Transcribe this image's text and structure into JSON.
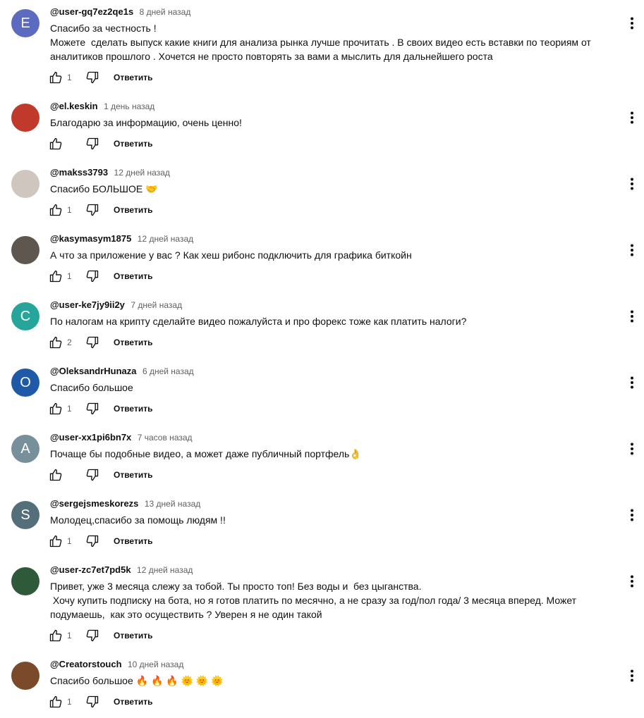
{
  "reply_label": "Ответить",
  "colors": {
    "author": "#0f0f0f",
    "meta": "#606060",
    "text": "#0f0f0f"
  },
  "comments": [
    {
      "author": "@user-gq7ez2qe1s",
      "time": "8 дней назад",
      "text": "Спасибо за честность !\nМожете  сделать выпуск какие книги для анализа рынка лучше прочитать . В своих видео есть вставки по теориям от аналитиков прошлого . Хочется не просто повторять за вами а мыслить для дальнейшего роста",
      "likes": "1",
      "avatar": {
        "letter": "E",
        "color": "#5c6bc0"
      }
    },
    {
      "author": "@el.keskin",
      "time": "1 день назад",
      "text": "Благодарю за информацию, очень ценно!",
      "likes": "",
      "avatar": {
        "letter": "",
        "color": "#c0392b",
        "icon": "user-photo"
      }
    },
    {
      "author": "@makss3793",
      "time": "12 дней назад",
      "text": "Спасибо БОЛЬШОЕ 🤝",
      "likes": "1",
      "avatar": {
        "letter": "",
        "color": "#cfc6c0",
        "icon": "user-photo"
      }
    },
    {
      "author": "@kasymasym1875",
      "time": "12 дней назад",
      "text": "А что за приложение у вас ? Как хеш рибонс подключить для графика биткойн",
      "likes": "1",
      "avatar": {
        "letter": "",
        "color": "#5d5750",
        "icon": "user-photo"
      }
    },
    {
      "author": "@user-ke7jy9ii2y",
      "time": "7 дней назад",
      "text": "По налогам на крипту сделайте видео пожалуйста и про форекс тоже как платить налоги?",
      "likes": "2",
      "avatar": {
        "letter": "C",
        "color": "#26a69a"
      }
    },
    {
      "author": "@OleksandrHunaza",
      "time": "6 дней назад",
      "text": "Спасибо большое",
      "likes": "1",
      "avatar": {
        "letter": "O",
        "color": "#1e5aa8"
      }
    },
    {
      "author": "@user-xx1pi6bn7x",
      "time": "7 часов назад",
      "text": "Почаще бы подобные видео, а может даже публичный портфель👌",
      "likes": "",
      "avatar": {
        "letter": "A",
        "color": "#78909c"
      }
    },
    {
      "author": "@sergejsmeskorezs",
      "time": "13 дней назад",
      "text": "Молодец,спасибо за помощь людям !!",
      "likes": "1",
      "avatar": {
        "letter": "S",
        "color": "#546e7a"
      }
    },
    {
      "author": "@user-zc7et7pd5k",
      "time": "12 дней назад",
      "text": "Привет, уже 3 месяца слежу за тобой. Ты просто топ! Без воды и  без цыганства.\n Хочу купить подписку на бота, но я готов платить по месячно, а не сразу за год/пол года/ 3 месяца вперед. Может подумаешь,  как это осуществить ? Уверен я не один такой",
      "likes": "1",
      "avatar": {
        "letter": "",
        "color": "#2f5a3a",
        "icon": "user-photo"
      }
    },
    {
      "author": "@Creatorstouch",
      "time": "10 дней назад",
      "text": "Спасибо большое 🔥 🔥 🔥 🌞 🌞 🌞",
      "likes": "1",
      "avatar": {
        "letter": "",
        "color": "#7a4a2a",
        "icon": "user-photo"
      }
    }
  ]
}
